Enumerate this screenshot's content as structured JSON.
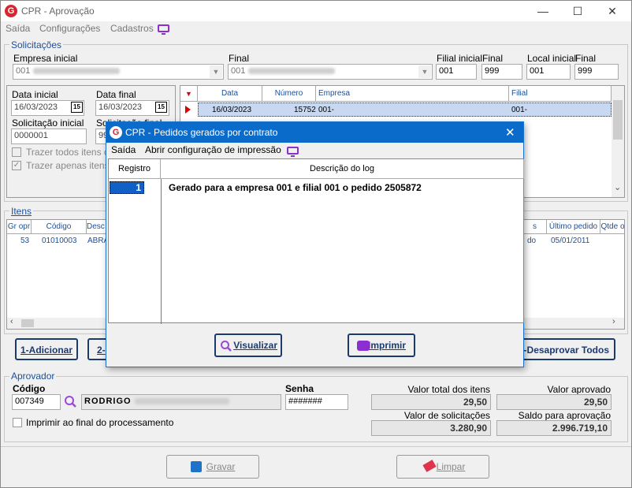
{
  "app": {
    "title": "CPR - Aprovação",
    "min": "—",
    "max": "☐",
    "close": "✕"
  },
  "menu": {
    "saida": "Saída",
    "config": "Configurações",
    "cadastros": "Cadastros"
  },
  "solicitacoes": {
    "group_label": "Solicitações",
    "empresa_inicial_label": "Empresa inicial",
    "empresa_inicial_value": "001",
    "final_label": "Final",
    "empresa_final_value": "001",
    "filial_inicial_label": "Filial inicial",
    "filial_inicial_value": "001",
    "filial_final_label": "Final",
    "filial_final_value": "999",
    "local_inicial_label": "Local inicial",
    "local_inicial_value": "001",
    "local_final_label": "Final",
    "local_final_value": "999",
    "data_inicial_label": "Data inicial",
    "data_inicial_value": "16/03/2023",
    "data_final_label": "Data final",
    "data_final_value": "16/03/2023",
    "sol_inicial_label": "Solicitação inicial",
    "sol_inicial_value": "0000001",
    "sol_final_label": "Solicitação final",
    "sol_final_value": "99",
    "trazer_todos": "Trazer todos itens con",
    "trazer_apenas": "Trazer apenas itens a",
    "cal_icon": "15"
  },
  "sol_grid": {
    "headers": [
      "Data",
      "Número",
      "Empresa",
      "Filial"
    ],
    "row": {
      "data": "16/03/2023",
      "numero": "15752",
      "empresa": "001-",
      "filial": "001-"
    }
  },
  "itens": {
    "group_label": "Itens",
    "headers": [
      "Gr opr",
      "Código",
      "Desc",
      "s",
      "Último pedido",
      "Qtde o"
    ],
    "row": {
      "gr": "53",
      "codigo": "01010003",
      "desc": "ABRA",
      "s": "do",
      "ultimo": "05/01/2011"
    }
  },
  "buttons": {
    "adicionar": "1-Adicionar",
    "b2": "2-",
    "desaprovar": "-Desaprovar Todos",
    "gravar": "Gravar",
    "limpar": "Limpar"
  },
  "aprovador": {
    "group_label": "Aprovador",
    "codigo_label": "Código",
    "codigo_value": "007349",
    "nome": "RODRIGO",
    "senha_label": "Senha",
    "senha_value": "#######",
    "imprimir_label": "Imprimir ao final do processamento",
    "valor_total_label": "Valor total dos itens",
    "valor_total": "29,50",
    "valor_aprovado_label": "Valor aprovado",
    "valor_aprovado": "29,50",
    "valor_sol_label": "Valor de solicitações aprovadas",
    "valor_sol": "3.280,90",
    "saldo_label": "Saldo para aprovação",
    "saldo": "2.996.719,10"
  },
  "dialog": {
    "title": "CPR - Pedidos gerados por contrato",
    "close": "✕",
    "menu_saida": "Saída",
    "menu_config": "Abrir configuração de impressão",
    "col_registro": "Registro",
    "col_descricao": "Descrição do log",
    "registro": "1",
    "descricao": "Gerado para a empresa 001 e filial 001 o pedido 2505872",
    "visualizar": "Visualizar",
    "imprimir": "Imprimir"
  }
}
